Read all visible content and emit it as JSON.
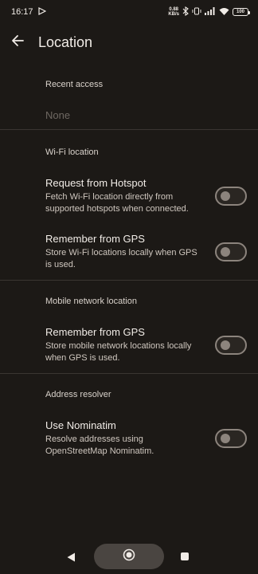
{
  "status_bar": {
    "time": "16:17",
    "net_speed_value": "0.88",
    "net_speed_unit": "KB/s",
    "battery": "100"
  },
  "app_bar": {
    "title": "Location"
  },
  "recent_access": {
    "header": "Recent access",
    "empty_text": "None"
  },
  "wifi_location": {
    "header": "Wi-Fi location",
    "items": [
      {
        "title": "Request from Hotspot",
        "description": "Fetch Wi-Fi location directly from supported hotspots when connected.",
        "enabled": false
      },
      {
        "title": "Remember from GPS",
        "description": "Store Wi-Fi locations locally when GPS is used.",
        "enabled": false
      }
    ]
  },
  "mobile_network_location": {
    "header": "Mobile network location",
    "items": [
      {
        "title": "Remember from GPS",
        "description": "Store mobile network locations locally when GPS is used.",
        "enabled": false
      }
    ]
  },
  "address_resolver": {
    "header": "Address resolver",
    "items": [
      {
        "title": "Use Nominatim",
        "description": "Resolve addresses using OpenStreetMap Nominatim.",
        "enabled": false
      }
    ]
  },
  "icons": {
    "back": "arrow-left-icon",
    "nav_back": "triangle-back-icon",
    "nav_home": "circle-home-icon",
    "nav_recents": "square-recents-icon"
  },
  "colors": {
    "background": "#1c1916",
    "text_primary": "#f1ece7",
    "text_disabled": "#6e6862",
    "toggle_off": "#8c847d"
  }
}
